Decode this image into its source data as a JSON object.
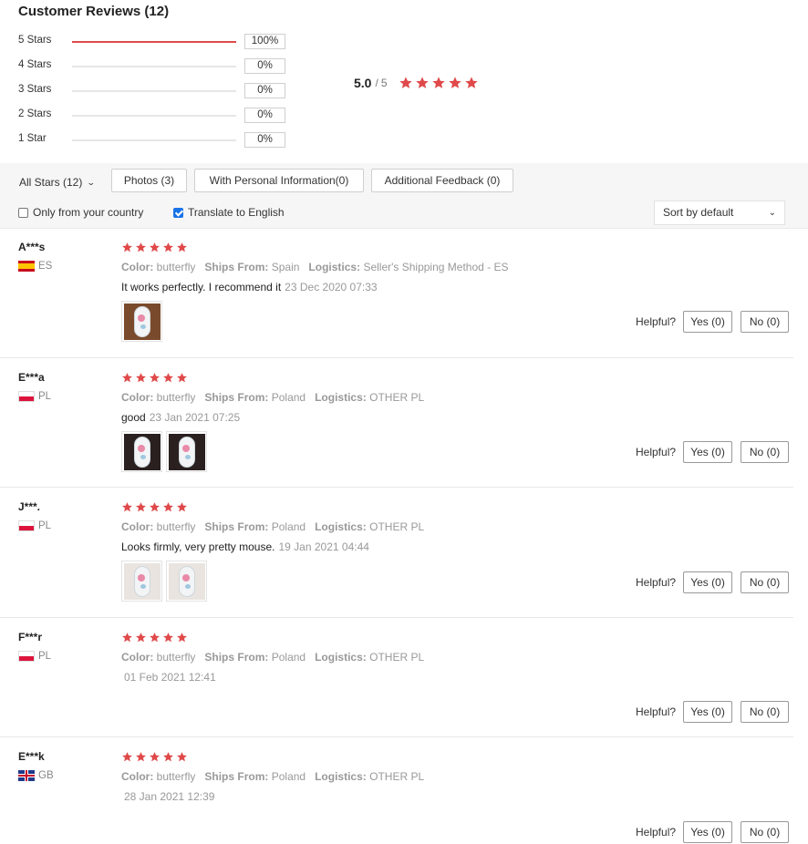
{
  "title": "Customer Reviews (12)",
  "colors": {
    "star": "#e0494a",
    "bar_fill": "#e0494a",
    "bar_track": "#e6e6e6",
    "checkbox": "#1a73e8"
  },
  "distribution": [
    {
      "label": "5 Stars",
      "percent_text": "100%",
      "fraction": 1.0
    },
    {
      "label": "4 Stars",
      "percent_text": "0%",
      "fraction": 0
    },
    {
      "label": "3 Stars",
      "percent_text": "0%",
      "fraction": 0
    },
    {
      "label": "2 Stars",
      "percent_text": "0%",
      "fraction": 0
    },
    {
      "label": "1 Star",
      "percent_text": "0%",
      "fraction": 0
    }
  ],
  "overall": {
    "score": "5.0",
    "separator": "/",
    "max": "5",
    "stars": 5
  },
  "filters": {
    "all_stars": "All Stars (12)",
    "photos": "Photos (3)",
    "personal": "With Personal Information(0)",
    "additional": "Additional Feedback (0)",
    "only_country": {
      "label": "Only from your country",
      "checked": false
    },
    "translate": {
      "label": "Translate to English",
      "checked": true
    },
    "sort": "Sort by default"
  },
  "labels": {
    "color": "Color:",
    "ships_from": "Ships From:",
    "logistics": "Logistics:",
    "helpful": "Helpful?"
  },
  "reviews": [
    {
      "user": "A***s",
      "country": "ES",
      "flag": "es",
      "rating": 5,
      "color": "butterfly",
      "ships_from": "Spain",
      "logistics": "Seller's Shipping Method - ES",
      "text": "It works perfectly. I recommend it",
      "date": "23 Dec 2020 07:33",
      "photos": [
        "mouse-photo"
      ],
      "yes": "Yes (0)",
      "no": "No (0)"
    },
    {
      "user": "E***a",
      "country": "PL",
      "flag": "pl",
      "rating": 5,
      "color": "butterfly",
      "ships_from": "Poland",
      "logistics": "OTHER PL",
      "text": "good",
      "date": "23 Jan 2021 07:25",
      "photos": [
        "mouse-photo",
        "mouse-photo"
      ],
      "yes": "Yes (0)",
      "no": "No (0)"
    },
    {
      "user": "J***.",
      "country": "PL",
      "flag": "pl",
      "rating": 5,
      "color": "butterfly",
      "ships_from": "Poland",
      "logistics": "OTHER PL",
      "text": "Looks firmly, very pretty mouse.",
      "date": "19 Jan 2021 04:44",
      "photos": [
        "mouse-photo",
        "mouse-photo"
      ],
      "yes": "Yes (0)",
      "no": "No (0)"
    },
    {
      "user": "F***r",
      "country": "PL",
      "flag": "pl",
      "rating": 5,
      "color": "butterfly",
      "ships_from": "Poland",
      "logistics": "OTHER PL",
      "text": "",
      "date": "01 Feb 2021 12:41",
      "photos": [],
      "yes": "Yes (0)",
      "no": "No (0)"
    },
    {
      "user": "E***k",
      "country": "GB",
      "flag": "gb",
      "rating": 5,
      "color": "butterfly",
      "ships_from": "Poland",
      "logistics": "OTHER PL",
      "text": "",
      "date": "28 Jan 2021 12:39",
      "photos": [],
      "yes": "Yes (0)",
      "no": "No (0)"
    }
  ]
}
